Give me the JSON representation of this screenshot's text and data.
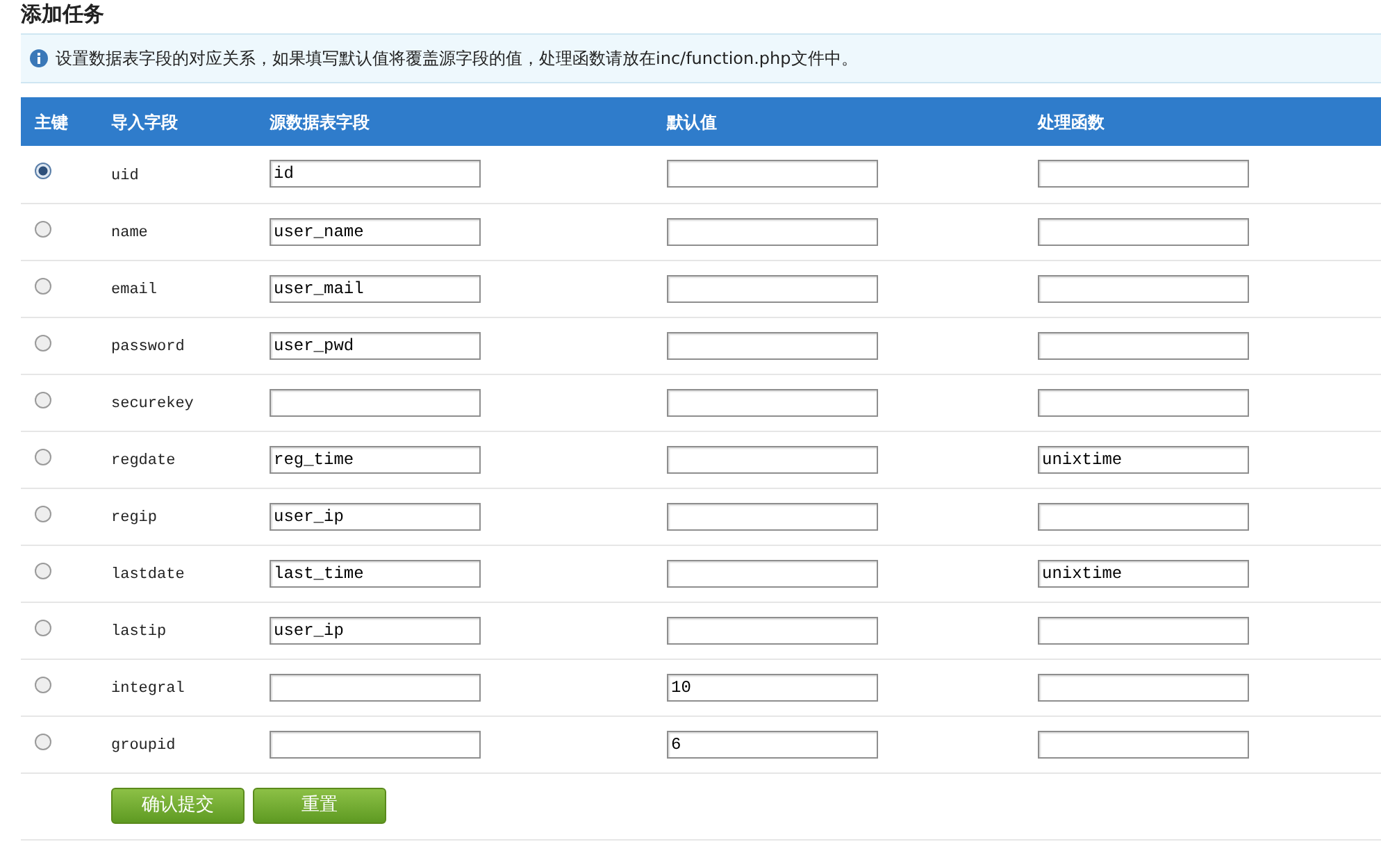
{
  "page": {
    "title": "添加任务"
  },
  "notice": {
    "text": "设置数据表字段的对应关系，如果填写默认值将覆盖源字段的值，处理函数请放在inc/function.php文件中。"
  },
  "table": {
    "columns": [
      "主键",
      "导入字段",
      "源数据表字段",
      "默认值",
      "处理函数"
    ],
    "rows": [
      {
        "selected": true,
        "field": "uid",
        "source": "id"
      },
      {
        "selected": false,
        "field": "name",
        "source": "user_name"
      },
      {
        "selected": false,
        "field": "email",
        "source": "user_mail"
      },
      {
        "selected": false,
        "field": "password",
        "source": "user_pwd"
      },
      {
        "selected": false,
        "field": "securekey"
      },
      {
        "selected": false,
        "field": "regdate",
        "source": "reg_time",
        "function": "unixtime"
      },
      {
        "selected": false,
        "field": "regip",
        "source": "user_ip"
      },
      {
        "selected": false,
        "field": "lastdate",
        "source": "last_time",
        "function": "unixtime"
      },
      {
        "selected": false,
        "field": "lastip",
        "source": "user_ip"
      },
      {
        "selected": false,
        "field": "integral",
        "default": "10"
      },
      {
        "selected": false,
        "field": "groupid",
        "default": "6"
      }
    ]
  },
  "buttons": [
    {
      "label": "确认提交"
    },
    {
      "label": "重置"
    }
  ]
}
